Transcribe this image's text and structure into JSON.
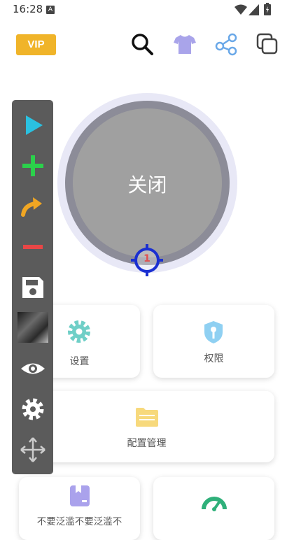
{
  "status_bar": {
    "time": "16:28",
    "notif_letter": "A"
  },
  "header": {
    "vip_label": "VIP"
  },
  "main_switch": {
    "label": "关闭",
    "target_count": "1"
  },
  "cards": {
    "settings": "设置",
    "permissions": "权限",
    "config_manage": "配置管理",
    "bottom_left": "不要泛滥不要泛滥不"
  },
  "colors": {
    "vip": "#f0b429",
    "accent_teal": "#6fcfc7",
    "toolbar_bg": "#5b5b5b"
  },
  "icons": [
    "search-icon",
    "tshirt-icon",
    "share-icon",
    "copy-icon",
    "play-icon",
    "plus-icon",
    "redo-arrow-icon",
    "minus-icon",
    "save-icon",
    "eye-icon",
    "gear-icon",
    "move-icon"
  ]
}
